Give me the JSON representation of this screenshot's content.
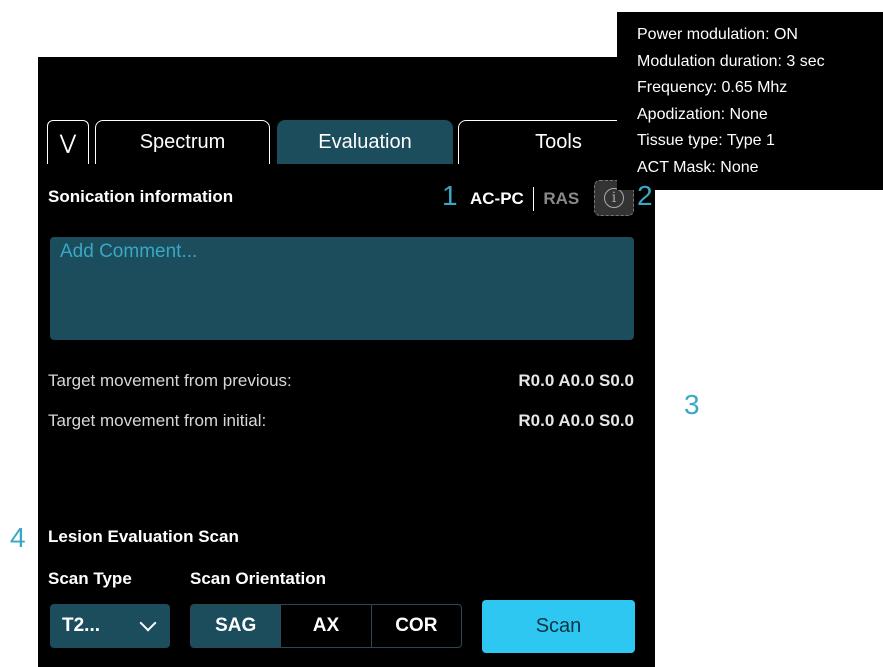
{
  "tabs": {
    "collapse_icon": "double-chevron-down-icon",
    "items": [
      {
        "label": "Spectrum",
        "active": false
      },
      {
        "label": "Evaluation",
        "active": true
      },
      {
        "label": "Tools",
        "active": false
      }
    ]
  },
  "sonication": {
    "title": "Sonication information",
    "coord_system": {
      "options": [
        "AC-PC",
        "RAS"
      ],
      "selected": "AC-PC"
    },
    "info_icon": "info-icon",
    "comment_placeholder": "Add Comment...",
    "comment_value": ""
  },
  "target_movement": [
    {
      "label": "Target movement from previous:",
      "value": "R0.0 A0.0 S0.0"
    },
    {
      "label": "Target movement from initial:",
      "value": "R0.0 A0.0 S0.0"
    }
  ],
  "lesion_scan": {
    "title": "Lesion Evaluation Scan",
    "scan_type_label": "Scan Type",
    "scan_type_value": "T2...",
    "scan_orientation_label": "Scan Orientation",
    "orientations": [
      "SAG",
      "AX",
      "COR"
    ],
    "selected_orientation": "SAG",
    "scan_button": "Scan"
  },
  "tooltip": {
    "lines": [
      "Power modulation: ON",
      "Modulation duration: 3 sec",
      "Frequency: 0.65 Mhz",
      "Apodization: None",
      "Tissue type: Type 1",
      "ACT Mask: None"
    ]
  },
  "callouts": [
    "1",
    "2",
    "3",
    "4"
  ],
  "colors": {
    "panel_bg": "#000000",
    "accent_dark": "#1b4d5c",
    "accent_bright": "#2ec7f2",
    "callout": "#3aa7c4"
  }
}
